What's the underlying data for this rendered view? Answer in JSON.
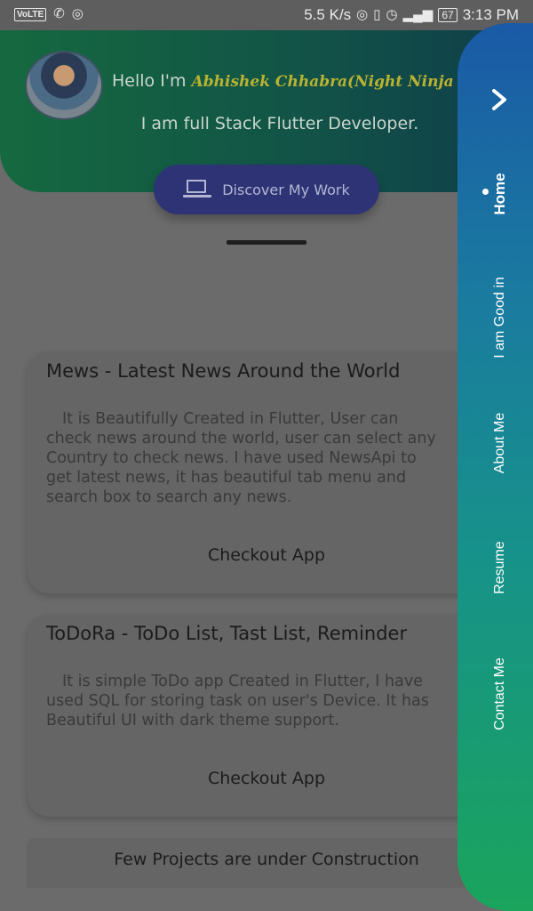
{
  "status_bar": {
    "left_icons": [
      "volte-icon",
      "whatsapp-icon",
      "hotspot-icon"
    ],
    "volte_label": "VoLTE",
    "speed": "5.5 K/s",
    "battery": "67",
    "time": "3:13 PM"
  },
  "header": {
    "greeting": "Hello I'm",
    "name": "Abhishek Chhabra(Night Ninja",
    "tagline": "I am full Stack Flutter Developer.",
    "discover_label": "Discover My Work"
  },
  "projects": [
    {
      "title": "Mews - Latest News Around the World",
      "description": "It is Beautifully Created in Flutter, User can check news around the world, user can select any Country to check news. I have used NewsApi to get latest news, it has beautiful tab menu and search box to search any news.",
      "button": "Checkout App"
    },
    {
      "title": "ToDoRa - ToDo List, Tast List, Reminder",
      "description": "It is simple ToDo app Created in Flutter, I have used SQL for storing task on user's Device. It has Beautiful UI with dark theme support.",
      "button": "Checkout App"
    }
  ],
  "under_construction": "Few Projects are under Construction",
  "side_nav": {
    "items": [
      "Home",
      "I am Good in",
      "About Me",
      "Resume",
      "Contact Me"
    ],
    "active": "Home"
  },
  "colors": {
    "header_start": "#15693f",
    "header_end": "#0f3d4a",
    "button": "#2d3375",
    "nav_top": "#1a5aa6",
    "nav_bottom": "#1aa45c",
    "name_accent": "#b9b232"
  }
}
